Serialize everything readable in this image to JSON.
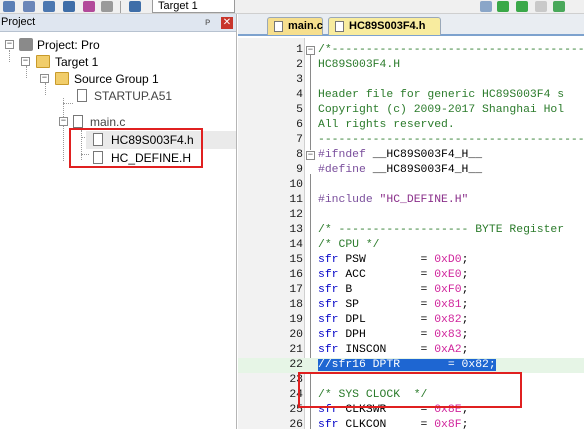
{
  "toolbar": {
    "target_select": "Target 1",
    "icons": [
      "save-icon",
      "save-all-icon",
      "build-icon",
      "rebuild-icon",
      "batch-build-icon",
      "download-icon",
      "target-options-icon",
      "manage-components-icon"
    ]
  },
  "project": {
    "title": "Project",
    "pin_glyph": "ᴘ",
    "close_glyph": "✕",
    "tree": {
      "root": "Project: Pro",
      "target": "Target 1",
      "group": "Source Group 1",
      "startup": "STARTUP.A51",
      "main_c": "main.c",
      "hc_header": "HC89S003F4.h",
      "define_header": "HC_DEFINE.H"
    },
    "toggles": {
      "root": "−",
      "target": "−",
      "group": "−",
      "main_c": "−"
    }
  },
  "editor": {
    "tabs": [
      "main.c",
      "HC89S003F4.h"
    ],
    "fold_minus": "−",
    "lines": [
      {
        "n": "1",
        "t": "/*----------------------------------------"
      },
      {
        "n": "2",
        "t": "HC89S003F4.H"
      },
      {
        "n": "3",
        "t": ""
      },
      {
        "n": "4",
        "t": "Header file for generic HC89S003F4 s"
      },
      {
        "n": "5",
        "t": "Copyright (c) 2009-2017 Shanghai Hol"
      },
      {
        "n": "6",
        "t": "All rights reserved."
      },
      {
        "n": "7",
        "t": "----------------------------------------"
      },
      {
        "n": "8",
        "a": "#ifndef",
        "b": " __HC89S003F4_H__"
      },
      {
        "n": "9",
        "a": "#define",
        "b": " __HC89S003F4_H__"
      },
      {
        "n": "10",
        "t": ""
      },
      {
        "n": "11",
        "a": "#include",
        "b": " \"HC_DEFINE.H\""
      },
      {
        "n": "12",
        "t": ""
      },
      {
        "n": "13",
        "t": "/* ------------------- BYTE Register"
      },
      {
        "n": "14",
        "t": "/* CPU */"
      },
      {
        "n": "15",
        "k": "sfr",
        "r": " PSW        = ",
        "v": "0xD0",
        "e": ";"
      },
      {
        "n": "16",
        "k": "sfr",
        "r": " ACC        = ",
        "v": "0xE0",
        "e": ";"
      },
      {
        "n": "17",
        "k": "sfr",
        "r": " B          = ",
        "v": "0xF0",
        "e": ";"
      },
      {
        "n": "18",
        "k": "sfr",
        "r": " SP         = ",
        "v": "0x81",
        "e": ";"
      },
      {
        "n": "19",
        "k": "sfr",
        "r": " DPL        = ",
        "v": "0x82",
        "e": ";"
      },
      {
        "n": "20",
        "k": "sfr",
        "r": " DPH        = ",
        "v": "0x83",
        "e": ";"
      },
      {
        "n": "21",
        "k": "sfr",
        "r": " INSCON     = ",
        "v": "0xA2",
        "e": ";"
      },
      {
        "n": "22",
        "sel": "//sfr16 DPTR       = 0x82;"
      },
      {
        "n": "23",
        "t": ""
      },
      {
        "n": "24",
        "t": "/* SYS CLOCK  */"
      },
      {
        "n": "25",
        "k": "sfr",
        "r": " CLKSWR     = ",
        "v": "0x8E",
        "e": ";"
      },
      {
        "n": "26",
        "k": "sfr",
        "r": " CLKCON     = ",
        "v": "0x8F",
        "e": ";"
      }
    ]
  },
  "colors": {
    "highlight_box": "#e02020",
    "comment": "#2b7b2b",
    "keyword": "#0000c8",
    "number": "#d0249c",
    "selection": "#1e66d2"
  }
}
